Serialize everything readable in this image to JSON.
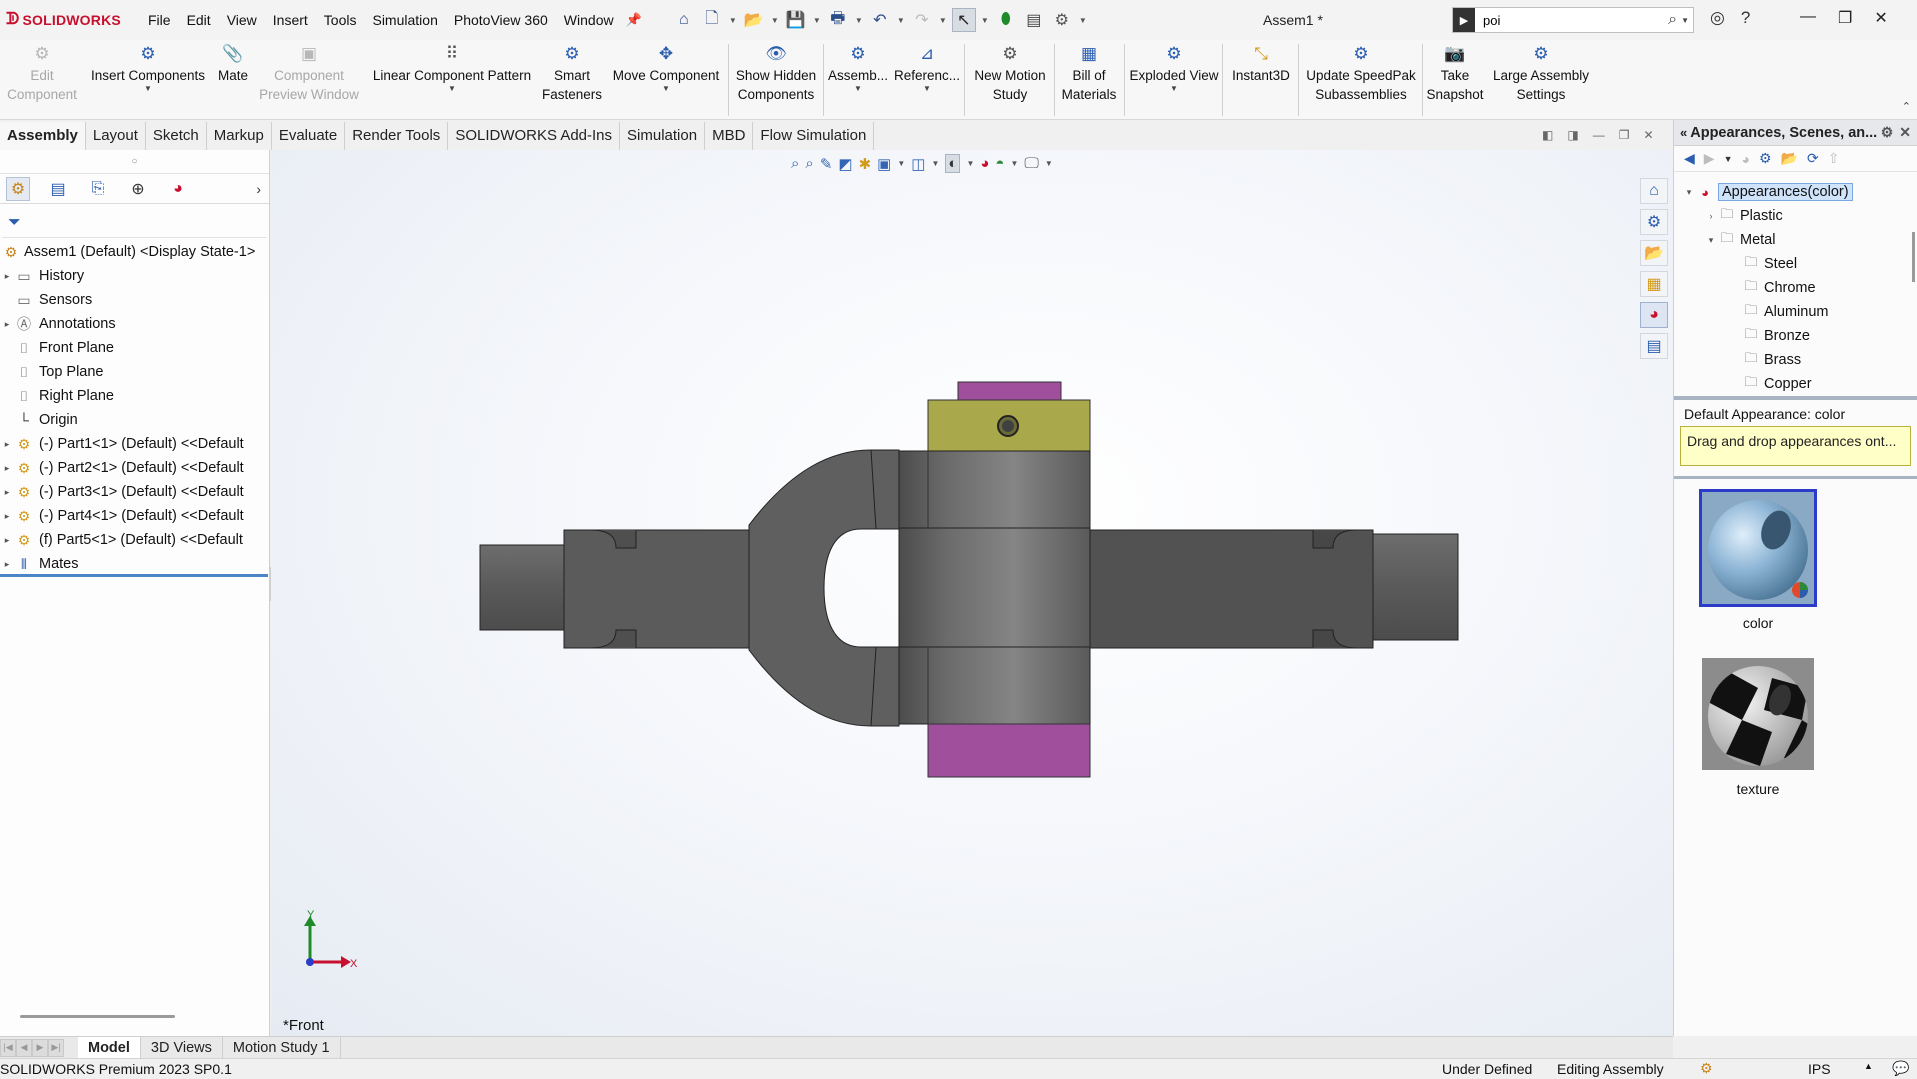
{
  "app": {
    "brand": "SOLIDWORKS",
    "document_title": "Assem1 *"
  },
  "menu": [
    "File",
    "Edit",
    "View",
    "Insert",
    "Tools",
    "Simulation",
    "PhotoView 360",
    "Window"
  ],
  "search": {
    "value": "poi"
  },
  "ribbon": {
    "edit_component": "Edit Component",
    "insert_components": "Insert Components",
    "mate": "Mate",
    "component_preview": "Component Preview Window",
    "linear_pattern": "Linear Component Pattern",
    "smart_fasteners": "Smart Fasteners",
    "move_component": "Move Component",
    "show_hidden": "Show Hidden Components",
    "assembly": "Assemb...",
    "reference": "Referenc...",
    "new_motion": "New Motion Study",
    "bom": "Bill of Materials",
    "exploded": "Exploded View",
    "instant3d": "Instant3D",
    "speedpak": "Update SpeedPak Subassemblies",
    "snapshot": "Take Snapshot",
    "large_assembly": "Large Assembly Settings"
  },
  "tabs": [
    "Assembly",
    "Layout",
    "Sketch",
    "Markup",
    "Evaluate",
    "Render Tools",
    "SOLIDWORKS Add-Ins",
    "Simulation",
    "MBD",
    "Flow Simulation"
  ],
  "feature_tree": {
    "root": "Assem1 (Default) <Display State-1>",
    "history": "History",
    "sensors": "Sensors",
    "annotations": "Annotations",
    "front_plane": "Front Plane",
    "top_plane": "Top Plane",
    "right_plane": "Right Plane",
    "origin": "Origin",
    "part1": "(-) Part1<1> (Default) <<Default",
    "part2": "(-) Part2<1> (Default) <<Default",
    "part3": "(-) Part3<1> (Default) <<Default",
    "part4": "(-) Part4<1> (Default) <<Default",
    "part5": "(f) Part5<1> (Default) <<Default",
    "mates": "Mates"
  },
  "viewport": {
    "view_label": "*Front",
    "triad_y": "Y",
    "triad_x": "X"
  },
  "task_pane": {
    "title": "Appearances, Scenes, an...",
    "root": "Appearances(color)",
    "plastic": "Plastic",
    "metal": "Metal",
    "steel": "Steel",
    "chrome": "Chrome",
    "aluminum": "Aluminum",
    "bronze": "Bronze",
    "brass": "Brass",
    "copper": "Copper",
    "default_appearance": "Default Appearance: color",
    "hint": "Drag and drop appearances ont...",
    "swatch_color": "color",
    "swatch_texture": "texture"
  },
  "bottom_tabs": [
    "Model",
    "3D Views",
    "Motion Study 1"
  ],
  "status": {
    "product": "SOLIDWORKS Premium 2023 SP0.1",
    "defined": "Under Defined",
    "editing": "Editing Assembly",
    "units": "IPS"
  },
  "colors": {
    "brand_red": "#c8102e",
    "accent_blue": "#2a5db0",
    "part_gray": "#5c5c5c",
    "collar_olive": "#a9a84a",
    "end_purple": "#a04f9c"
  }
}
